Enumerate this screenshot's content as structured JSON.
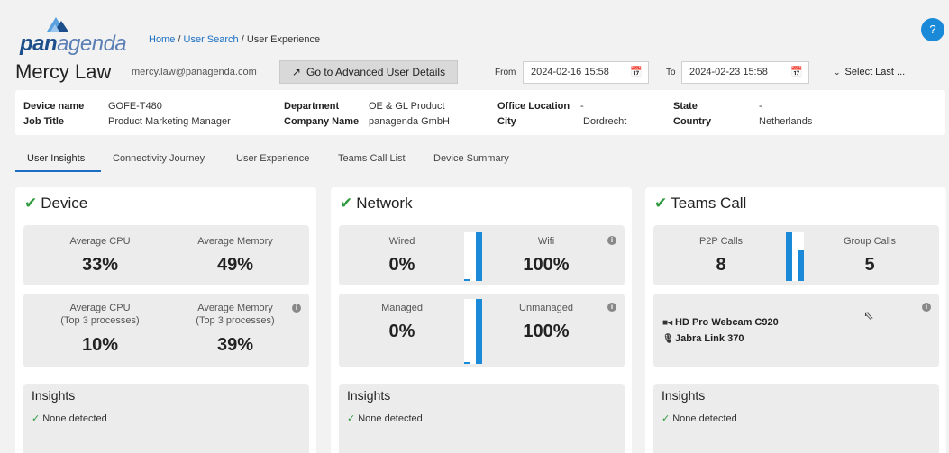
{
  "header": {
    "logo_bold": "pan",
    "logo_light": "agenda",
    "breadcrumb_home": "Home",
    "breadcrumb_search": "User Search",
    "breadcrumb_current": "User Experience",
    "help_label": "?"
  },
  "user": {
    "name": "Mercy Law",
    "email": "mercy.law@panagenda.com",
    "advanced_button": "Go to Advanced User Details"
  },
  "date_range": {
    "from_label": "From",
    "from_value": "2024-02-16 15:58",
    "to_label": "To",
    "to_value": "2024-02-23 15:58",
    "select_last": "Select Last ..."
  },
  "details": {
    "device_name_label": "Device name",
    "device_name": "GOFE-T480",
    "job_title_label": "Job Title",
    "job_title": "Product Marketing Manager",
    "department_label": "Department",
    "department": "OE & GL Product",
    "company_label": "Company Name",
    "company": "panagenda GmbH",
    "office_label": "Office Location",
    "office": "-",
    "city_label": "City",
    "city": "Dordrecht",
    "state_label": "State",
    "state": "-",
    "country_label": "Country",
    "country": "Netherlands"
  },
  "tabs": [
    {
      "label": "User Insights"
    },
    {
      "label": "Connectivity Journey"
    },
    {
      "label": "User Experience"
    },
    {
      "label": "Teams Call List"
    },
    {
      "label": "Device Summary"
    }
  ],
  "device_panel": {
    "title": "Device",
    "avg_cpu_label": "Average CPU",
    "avg_cpu": "33%",
    "avg_mem_label": "Average Memory",
    "avg_mem": "49%",
    "top_cpu_label": "Average CPU",
    "top_cpu_sub": "(Top 3 processes)",
    "top_cpu": "10%",
    "top_mem_label": "Average Memory",
    "top_mem_sub": "(Top 3 processes)",
    "top_mem": "39%",
    "insights_title": "Insights",
    "insights_none": "None detected"
  },
  "network_panel": {
    "title": "Network",
    "wired_label": "Wired",
    "wired": "0%",
    "wifi_label": "Wifi",
    "wifi": "100%",
    "wired_fraction": 0.0,
    "wifi_fraction": 1.0,
    "managed_label": "Managed",
    "managed": "0%",
    "unmanaged_label": "Unmanaged",
    "unmanaged": "100%",
    "managed_fraction": 0.0,
    "unmanaged_fraction": 1.0,
    "insights_title": "Insights",
    "insights_none": "None detected"
  },
  "teams_panel": {
    "title": "Teams Call",
    "p2p_label": "P2P Calls",
    "p2p": "8",
    "group_label": "Group Calls",
    "group": "5",
    "p2p_count": 8,
    "group_count": 5,
    "camera": "HD Pro Webcam C920",
    "microphone": "Jabra Link 370",
    "insights_title": "Insights",
    "insights_none": "None detected"
  },
  "colors": {
    "accent": "#1a8ad8",
    "check": "#2e9a3d",
    "link": "#1a6fc2"
  }
}
